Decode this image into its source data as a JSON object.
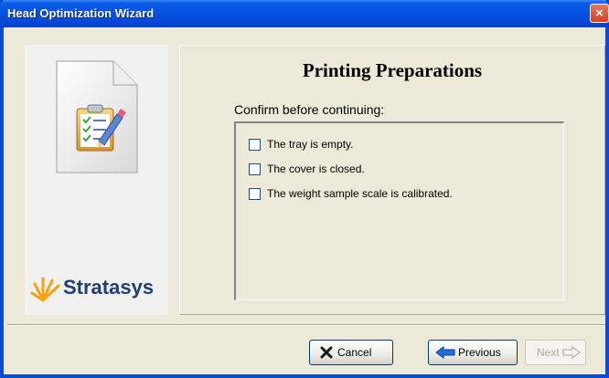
{
  "window": {
    "title": "Head Optimization Wizard",
    "close_symbol": "×"
  },
  "sidebar": {
    "logo_text": "Stratasys"
  },
  "main": {
    "title": "Printing Preparations",
    "confirm_label": "Confirm before continuing:",
    "checklist": [
      {
        "label": "The tray is empty.",
        "checked": false
      },
      {
        "label": "The cover is closed.",
        "checked": false
      },
      {
        "label": "The weight sample scale is calibrated.",
        "checked": false
      }
    ]
  },
  "buttons": {
    "cancel": {
      "label": "Cancel",
      "enabled": true
    },
    "previous": {
      "label": "Previous",
      "enabled": true
    },
    "next": {
      "label": "Next",
      "enabled": false
    }
  },
  "colors": {
    "titlebar": "#0650e0",
    "close_button": "#d3411f",
    "cancel_icon": "#1a1a1a",
    "previous_arrow": "#1c6fe0",
    "logo_text": "#1f3f73",
    "logo_burst": "#f5a312"
  },
  "icons": {
    "sidebar_icon": "clipboard-checklist-icon",
    "cancel_icon": "x-icon",
    "previous_icon": "arrow-left-icon",
    "next_icon": "arrow-right-icon"
  }
}
